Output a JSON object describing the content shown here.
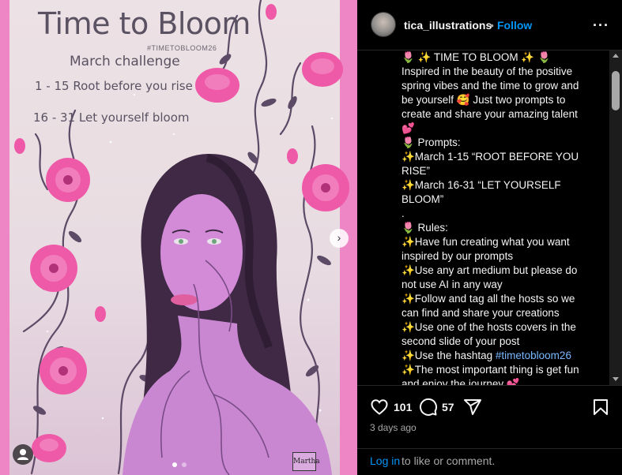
{
  "post_image": {
    "poster_title": "Time to Bloom",
    "poster_tag": "#TIMETOBLOOM26",
    "poster_subtitle": "March challenge",
    "poster_line1": "1 - 15  Root before you rise",
    "poster_line2": "16 - 31  Let yourself bloom",
    "signature": "Martha",
    "next_icon": "chevron-right-icon",
    "tagged_icon": "person-icon",
    "carousel_dots": [
      true,
      false
    ],
    "colors": {
      "frame_pink": "#ee86c5",
      "rose": "#ee5aa8",
      "vine": "#5c4a66",
      "face": "#d38bd8"
    }
  },
  "header": {
    "username": "tica_illustrations",
    "separator": "•",
    "follow_label": "Follow",
    "more_icon": "more-horizontal-icon"
  },
  "caption": {
    "lines": [
      "🌷 ✨ TIME TO BLOOM ✨ 🌷",
      "Inspired in the beauty of the positive",
      "spring vibes and the time to grow and",
      "be yourself 🥰 Just two prompts to",
      "create and share your amazing talent",
      "💕",
      "🌷 Prompts:",
      "✨March 1-15 “ROOT BEFORE YOU",
      "RISE”",
      "✨March 16-31 “LET YOURSELF",
      "BLOOM”",
      ".",
      "🌷 Rules:",
      "✨Have fun creating what you want",
      "inspired by our prompts",
      "✨Use any art medium but please do",
      "not use AI in any way",
      "✨Follow and tag all the hosts so we",
      "can find and share your creations",
      "✨Use one of the hosts covers in the",
      "second slide of your post"
    ],
    "hashtag_prefix": "✨Use the hashtag ",
    "hashtag": "#timetobloom26",
    "line_after": "✨The most important thing is get fun",
    "line_cut": "and enjoy the journey 💕"
  },
  "actions": {
    "like_icon": "heart-icon",
    "like_count": "101",
    "comment_icon": "comment-icon",
    "comment_count": "57",
    "share_icon": "send-icon",
    "save_icon": "bookmark-icon",
    "timestamp": "3 days ago"
  },
  "login": {
    "link_label": "Log in",
    "rest_text": "to like or comment."
  }
}
